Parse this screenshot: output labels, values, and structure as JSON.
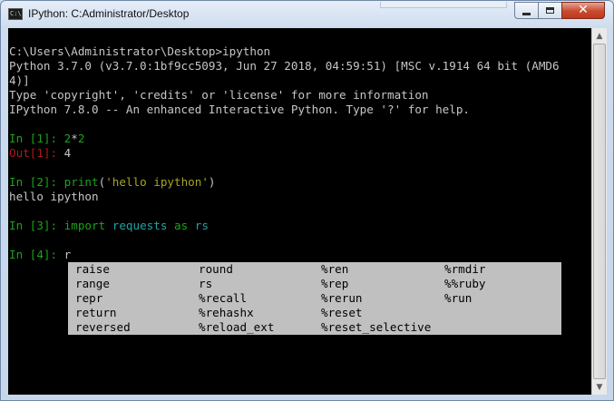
{
  "window": {
    "title": "IPython: C:Administrator/Desktop",
    "icon": "console-icon",
    "icon_text": "C:\\"
  },
  "console": {
    "lines": [
      "C:\\Users\\Administrator\\Desktop>ipython",
      "Python 3.7.0 (v3.7.0:1bf9cc5093, Jun 27 2018, 04:59:51) [MSC v.1914 64 bit (AMD6",
      "4)]",
      "Type 'copyright', 'credits' or 'license' for more information",
      "IPython 7.8.0 -- An enhanced Interactive Python. Type '?' for help."
    ],
    "cells": [
      {
        "in_prompt": "In [1]: ",
        "code_a": "2",
        "code_op": "*",
        "code_b": "2",
        "out_prompt": "Out[1]: ",
        "out_value": "4"
      },
      {
        "in_prompt": "In [2]: ",
        "code_func": "print",
        "code_open": "(",
        "code_str": "'hello ipython'",
        "code_close": ")",
        "output": "hello ipython"
      },
      {
        "in_prompt": "In [3]: ",
        "kw1": "import",
        "mod": "requests",
        "kw2": "as",
        "alias": "rs"
      },
      {
        "in_prompt": "In [4]: ",
        "typed": "r"
      }
    ],
    "completions": [
      [
        "raise",
        "round",
        "%ren",
        "%rmdir"
      ],
      [
        "range",
        "rs",
        "%rep",
        "%%ruby"
      ],
      [
        "repr",
        "%recall",
        "%rerun",
        "%run"
      ],
      [
        "return",
        "%rehashx",
        "%reset",
        ""
      ],
      [
        "reversed",
        "%reload_ext",
        "%reset_selective",
        ""
      ]
    ]
  },
  "controls": {
    "minimize": "minimize-button",
    "maximize": "maximize-button",
    "close": "close-button"
  },
  "colors": {
    "background": "#000000",
    "prompt_in": "#1aa31a",
    "prompt_out": "#b01818",
    "string": "#a7a51e",
    "module": "#24a3a3",
    "completion_bg": "#c0c0c0"
  }
}
